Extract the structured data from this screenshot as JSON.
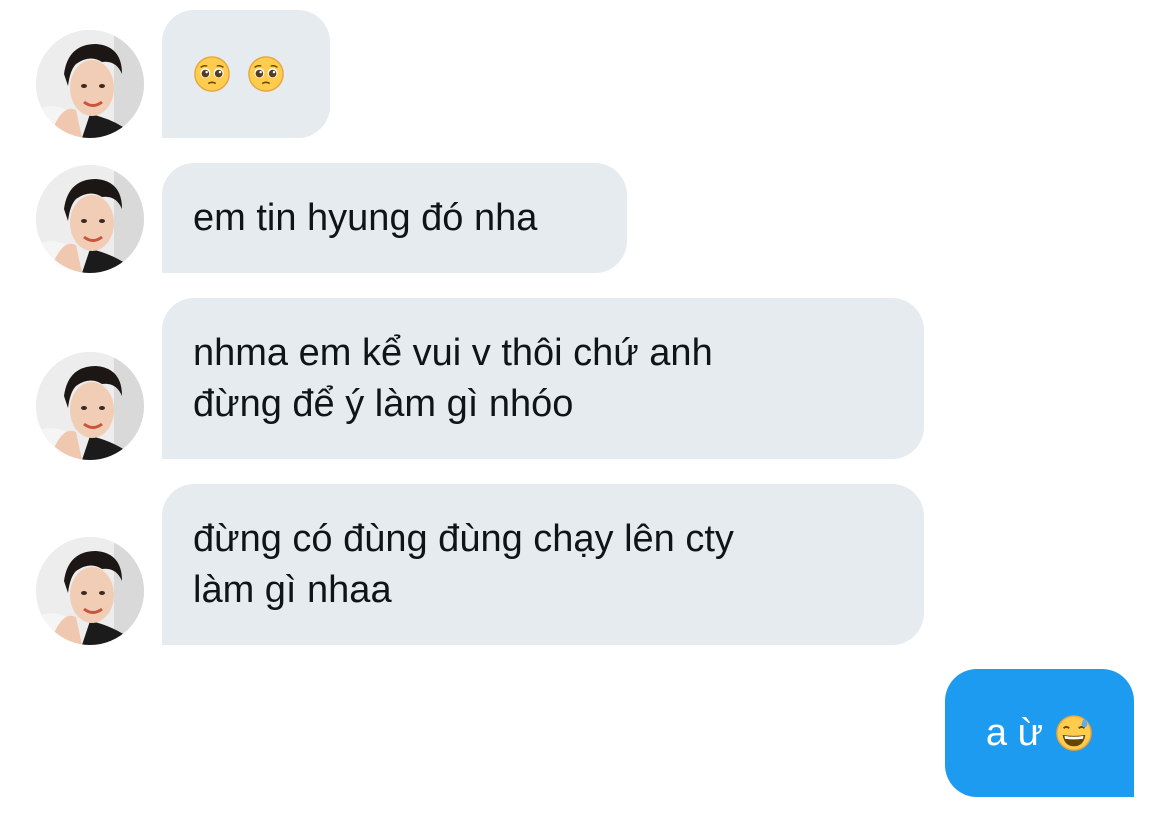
{
  "messages": [
    {
      "side": "incoming",
      "lines": [],
      "emojis": [
        "pleading-face",
        "pleading-face"
      ]
    },
    {
      "side": "incoming",
      "lines": [
        "em tin hyung đó nha"
      ]
    },
    {
      "side": "incoming",
      "lines": [
        "nhma em kể vui v thôi chứ anh",
        "đừng để ý làm gì nhóo"
      ]
    },
    {
      "side": "incoming",
      "lines": [
        "đừng có đùng đùng chạy lên cty",
        "làm gì nhaa"
      ]
    },
    {
      "side": "outgoing",
      "text": "a ừ",
      "emoji": "grinning-sweat-face"
    }
  ],
  "colors": {
    "incoming_bubble": "#e6ebef",
    "outgoing_bubble": "#1d9bf0",
    "incoming_text": "#0f1419",
    "outgoing_text": "#ffffff"
  }
}
